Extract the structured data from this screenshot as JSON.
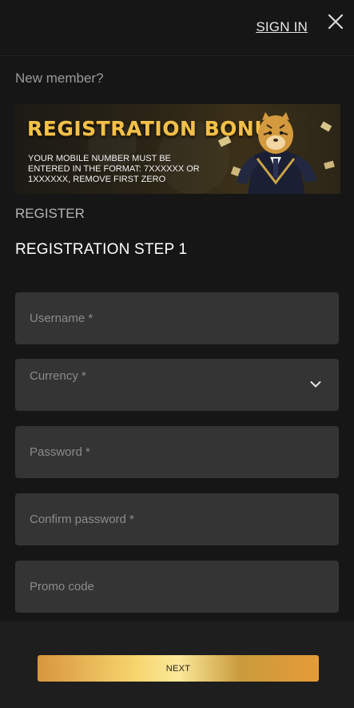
{
  "header": {
    "signin_label": "SIGN IN"
  },
  "intro": {
    "new_member": "New member?"
  },
  "banner": {
    "title": "REGISTRATION BONUS",
    "notice": "YOUR MOBILE NUMBER MUST BE ENTERED IN THE FORMAT: 7XXXXXX or 1XXXXXX, REMOVE FIRST ZERO"
  },
  "section": {
    "register_label": "REGISTER",
    "step_title": "REGISTRATION STEP 1"
  },
  "form": {
    "username": "Username *",
    "currency": "Currency *",
    "password": "Password *",
    "confirm_password": "Confirm password *",
    "promo_code": "Promo code"
  },
  "footer": {
    "next_label": "NEXT"
  },
  "colors": {
    "background": "#161616",
    "field": "#343434",
    "accent_gold": "#f3c04a"
  }
}
